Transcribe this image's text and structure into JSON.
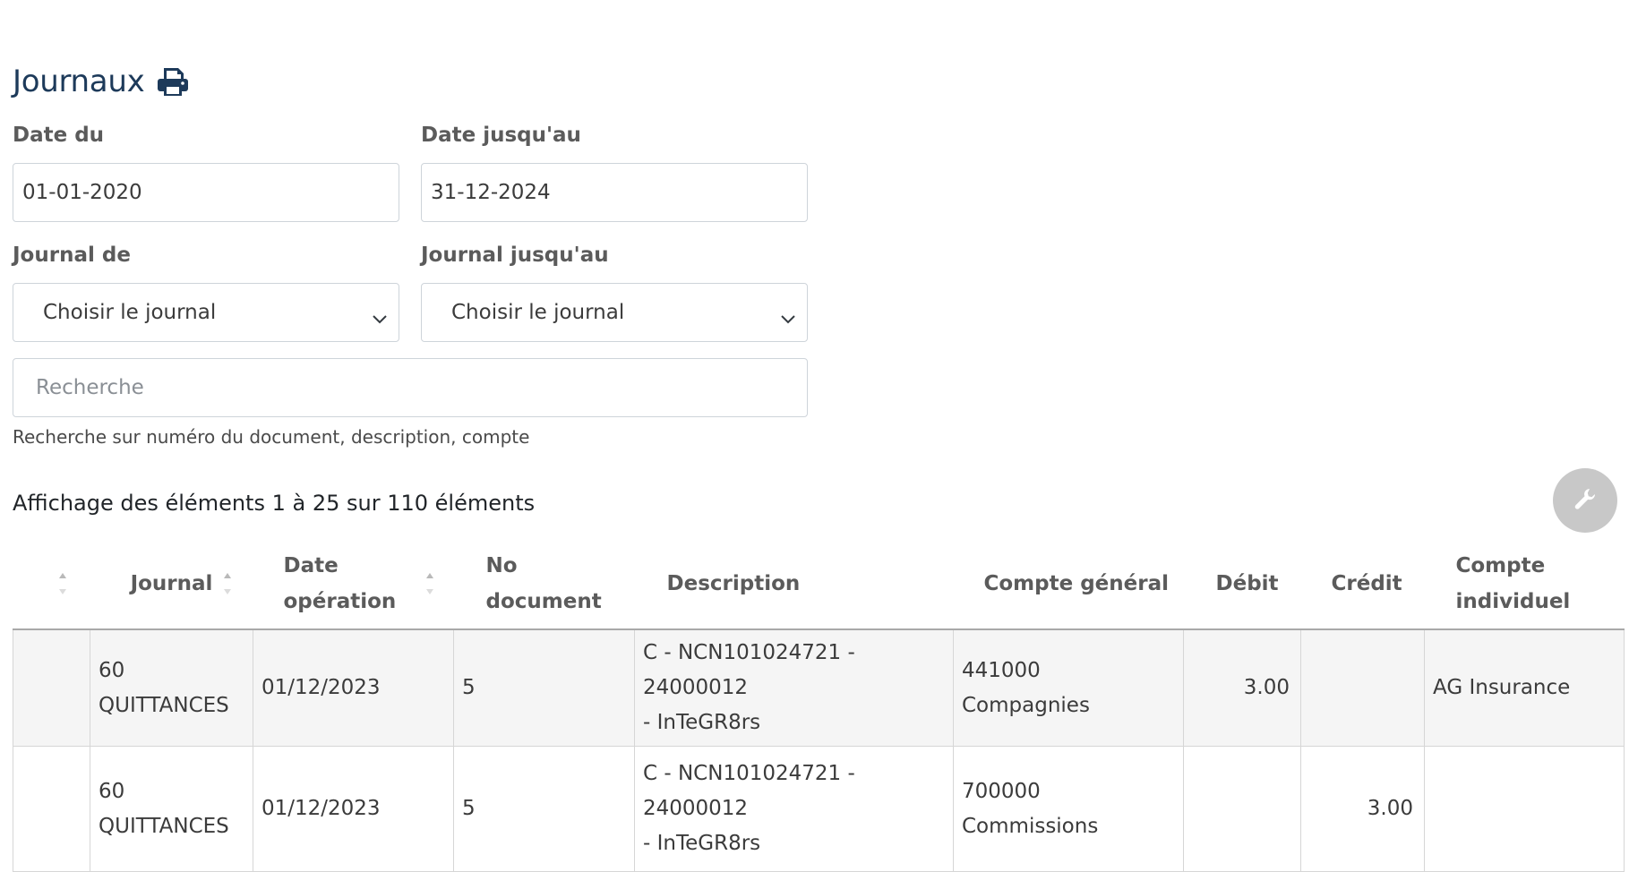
{
  "page": {
    "title": "Journaux",
    "print_icon": "printer-icon"
  },
  "filters": {
    "date_from_label": "Date du",
    "date_from_value": "01-01-2020",
    "date_to_label": "Date jusqu'au",
    "date_to_value": "31-12-2024",
    "journal_from_label": "Journal de",
    "journal_from_value": "Choisir le journal",
    "journal_to_label": "Journal jusqu'au",
    "journal_to_value": "Choisir le journal",
    "search_placeholder": "Recherche",
    "search_help": "Recherche sur numéro du document, description, compte"
  },
  "listing": {
    "info": "Affichage des éléments 1 à 25 sur 110 éléments",
    "tool_icon": "wrench-icon"
  },
  "table": {
    "headers": {
      "c0": "",
      "journal": "Journal",
      "date_line1": "Date",
      "date_line2": "opération",
      "doc_line1": "No",
      "doc_line2": "document",
      "description": "Description",
      "compte": "Compte général",
      "debit": "Débit",
      "credit": "Crédit",
      "indiv_line1": "Compte",
      "indiv_line2": "individuel"
    },
    "rows": [
      {
        "journal_line1": "60",
        "journal_line2": "QUITTANCES",
        "date": "01/12/2023",
        "doc": "5",
        "desc_line1": "C - NCN101024721 - 24000012",
        "desc_line2": "- InTeGR8rs",
        "compte_line1": "441000 Compagnies",
        "compte_line2": "",
        "debit": "3.00",
        "credit": "",
        "indiv": "AG Insurance"
      },
      {
        "journal_line1": "60",
        "journal_line2": "QUITTANCES",
        "date": "01/12/2023",
        "doc": "5",
        "desc_line1": "C - NCN101024721 - 24000012",
        "desc_line2": "- InTeGR8rs",
        "compte_line1": "700000",
        "compte_line2": "Commissions",
        "debit": "",
        "credit": "3.00",
        "indiv": ""
      }
    ]
  }
}
